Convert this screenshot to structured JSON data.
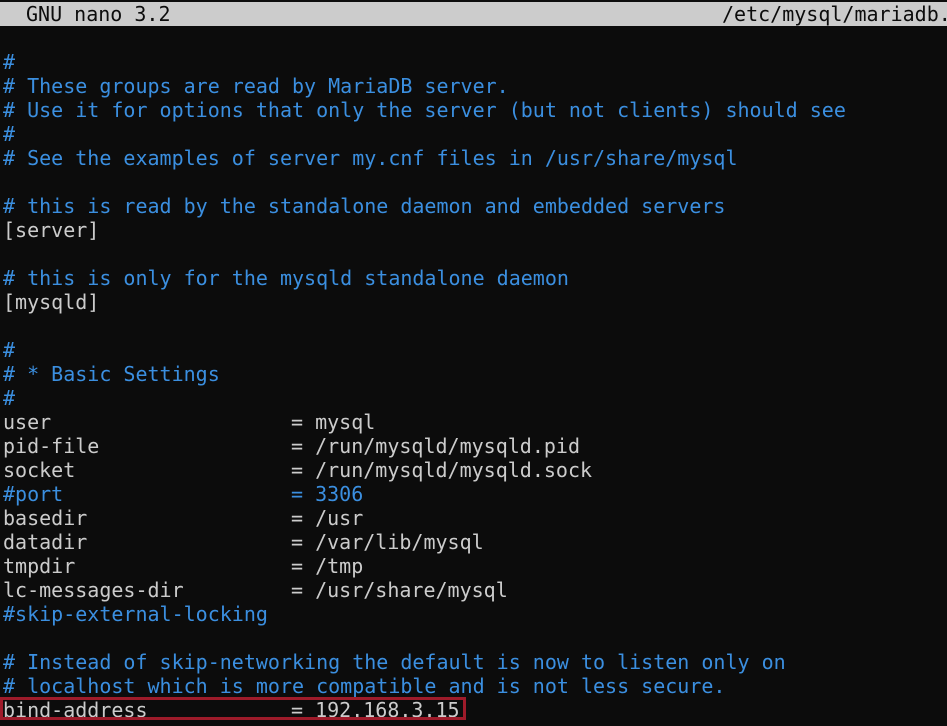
{
  "titlebar": {
    "app": "GNU nano 3.2",
    "file": "/etc/mysql/mariadb."
  },
  "lines": [
    {
      "kind": "comment",
      "text": "#"
    },
    {
      "kind": "comment",
      "text": "# These groups are read by MariaDB server."
    },
    {
      "kind": "comment",
      "text": "# Use it for options that only the server (but not clients) should see"
    },
    {
      "kind": "comment",
      "text": "#"
    },
    {
      "kind": "comment",
      "text": "# See the examples of server my.cnf files in /usr/share/mysql"
    },
    {
      "kind": "blank",
      "text": ""
    },
    {
      "kind": "comment",
      "text": "# this is read by the standalone daemon and embedded servers"
    },
    {
      "kind": "plain",
      "text": "[server]"
    },
    {
      "kind": "blank",
      "text": ""
    },
    {
      "kind": "comment",
      "text": "# this is only for the mysqld standalone daemon"
    },
    {
      "kind": "plain",
      "text": "[mysqld]"
    },
    {
      "kind": "blank",
      "text": ""
    },
    {
      "kind": "comment",
      "text": "#"
    },
    {
      "kind": "comment",
      "text": "# * Basic Settings"
    },
    {
      "kind": "comment",
      "text": "#"
    },
    {
      "kind": "setting",
      "key": "user",
      "value": "= mysql",
      "commented": false
    },
    {
      "kind": "setting",
      "key": "pid-file",
      "value": "= /run/mysqld/mysqld.pid",
      "commented": false
    },
    {
      "kind": "setting",
      "key": "socket",
      "value": "= /run/mysqld/mysqld.sock",
      "commented": false
    },
    {
      "kind": "setting",
      "key": "#port",
      "value": "= 3306",
      "commented": true
    },
    {
      "kind": "setting",
      "key": "basedir",
      "value": "= /usr",
      "commented": false
    },
    {
      "kind": "setting",
      "key": "datadir",
      "value": "= /var/lib/mysql",
      "commented": false
    },
    {
      "kind": "setting",
      "key": "tmpdir",
      "value": "= /tmp",
      "commented": false
    },
    {
      "kind": "setting",
      "key": "lc-messages-dir",
      "value": "= /usr/share/mysql",
      "commented": false
    },
    {
      "kind": "comment",
      "text": "#skip-external-locking"
    },
    {
      "kind": "blank",
      "text": ""
    },
    {
      "kind": "comment",
      "text": "# Instead of skip-networking the default is now to listen only on"
    },
    {
      "kind": "comment",
      "text": "# localhost which is more compatible and is not less secure."
    },
    {
      "kind": "setting",
      "key": "bind-address",
      "value": "= 192.168.3.15",
      "commented": false,
      "highlighted": true
    }
  ],
  "colors": {
    "background": "#0c0c0c",
    "text": "#cccccc",
    "comment": "#3b8fe0",
    "highlight_border": "#9e1b2a"
  }
}
